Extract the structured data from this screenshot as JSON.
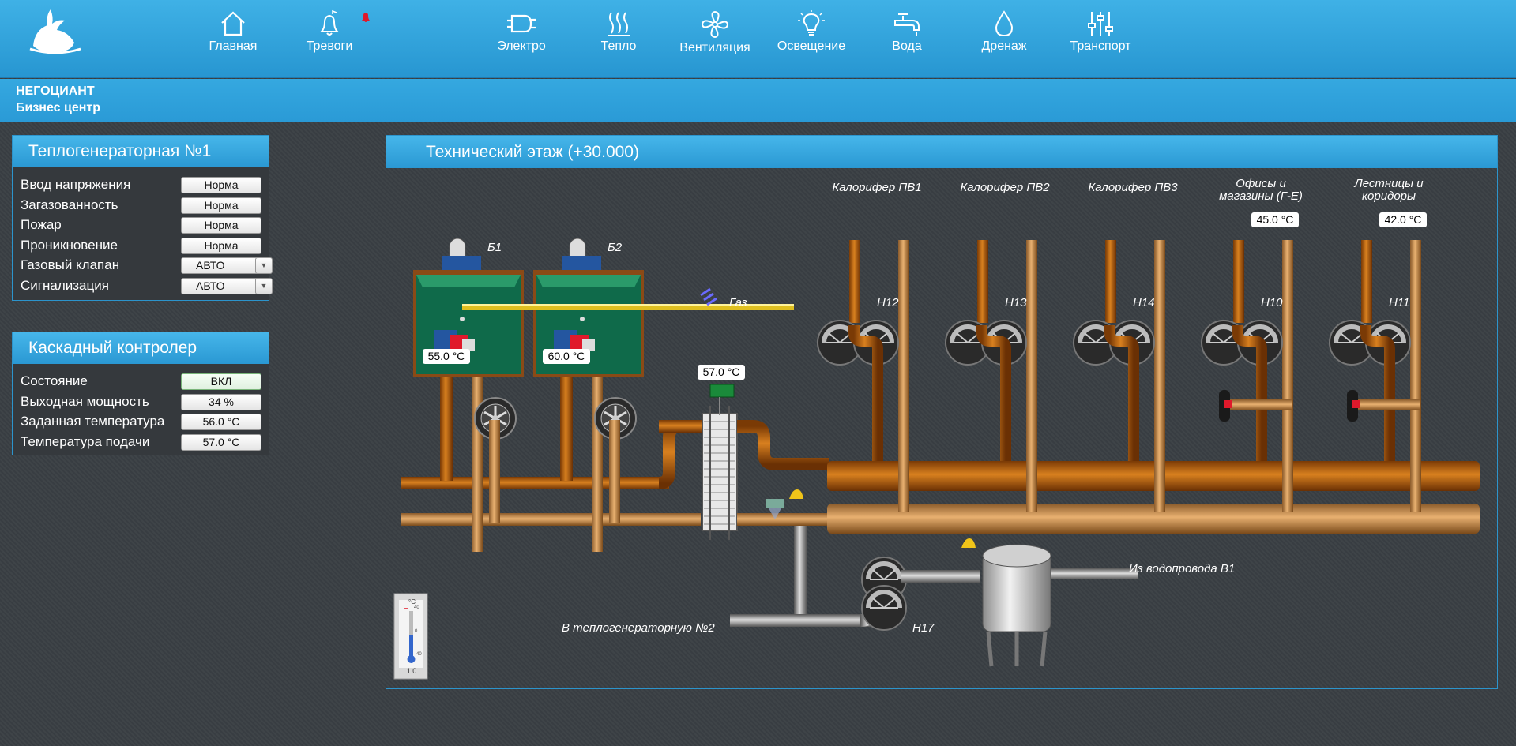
{
  "nav": [
    {
      "label": "Главная",
      "icon": "home-icon"
    },
    {
      "label": "Тревоги",
      "icon": "bell-icon"
    },
    {
      "label": "Электро",
      "icon": "plug-icon"
    },
    {
      "label": "Тепло",
      "icon": "heat-icon"
    },
    {
      "label": "Вентиляция",
      "icon": "fan-icon"
    },
    {
      "label": "Освещение",
      "icon": "bulb-icon"
    },
    {
      "label": "Вода",
      "icon": "faucet-icon"
    },
    {
      "label": "Дренаж",
      "icon": "drop-icon"
    },
    {
      "label": "Транспорт",
      "icon": "sliders-icon"
    }
  ],
  "org": {
    "name": "НЕГОЦИАНТ",
    "subtitle": "Бизнес центр"
  },
  "panel1": {
    "title": "Теплогенераторная №1",
    "rows": [
      {
        "label": "Ввод напряжения",
        "value": "Норма"
      },
      {
        "label": "Загазованность",
        "value": "Норма"
      },
      {
        "label": "Пожар",
        "value": "Норма"
      },
      {
        "label": "Проникновение",
        "value": "Норма"
      },
      {
        "label": "Газовый клапан",
        "value": "АВТО"
      },
      {
        "label": "Сигнализация",
        "value": "АВТО"
      }
    ]
  },
  "panel2": {
    "title": "Каскадный контролер",
    "rows": [
      {
        "label": "Состояние",
        "value": "ВКЛ"
      },
      {
        "label": "Выходная мощность",
        "value": "34 %"
      },
      {
        "label": "Заданная температура",
        "value": "56.0 °C"
      },
      {
        "label": "Температура подачи",
        "value": "57.0 °C"
      }
    ]
  },
  "scheme": {
    "title": "Технический этаж (+30.000)",
    "boilers": [
      {
        "name": "Б1",
        "temp": "55.0 °C"
      },
      {
        "name": "Б2",
        "temp": "60.0 °C"
      }
    ],
    "gas_label": "Газ",
    "hx_temp": "57.0 °C",
    "consumers": [
      {
        "label_line1": "Калорифер ПВ1",
        "label_line2": "",
        "pump": "Н12",
        "temp": ""
      },
      {
        "label_line1": "Калорифер ПВ2",
        "label_line2": "",
        "pump": "Н13",
        "temp": ""
      },
      {
        "label_line1": "Калорифер ПВ3",
        "label_line2": "",
        "pump": "Н14",
        "temp": ""
      },
      {
        "label_line1": "Офисы и",
        "label_line2": "магазины (Г-Е)",
        "pump": "Н10",
        "temp": "45.0 °C"
      },
      {
        "label_line1": "Лестницы и",
        "label_line2": "коридоры",
        "pump": "Н11",
        "temp": "42.0 °C"
      }
    ],
    "water_in_label": "Из водопровода В1",
    "to_gen2_label": "В теплогенераторную №2",
    "makeup_pump": "Н17",
    "thermometer": {
      "unit": "°C",
      "value": "1.0",
      "tick_top": "40",
      "tick_mid": "0",
      "tick_bot": "-40"
    }
  },
  "colors": {
    "accent": "#2a98d3",
    "pipe_hot": "#b8610f",
    "pipe_return": "#c98a45",
    "pipe_cold": "#9a9a9a",
    "alarm": "#e0192b"
  }
}
